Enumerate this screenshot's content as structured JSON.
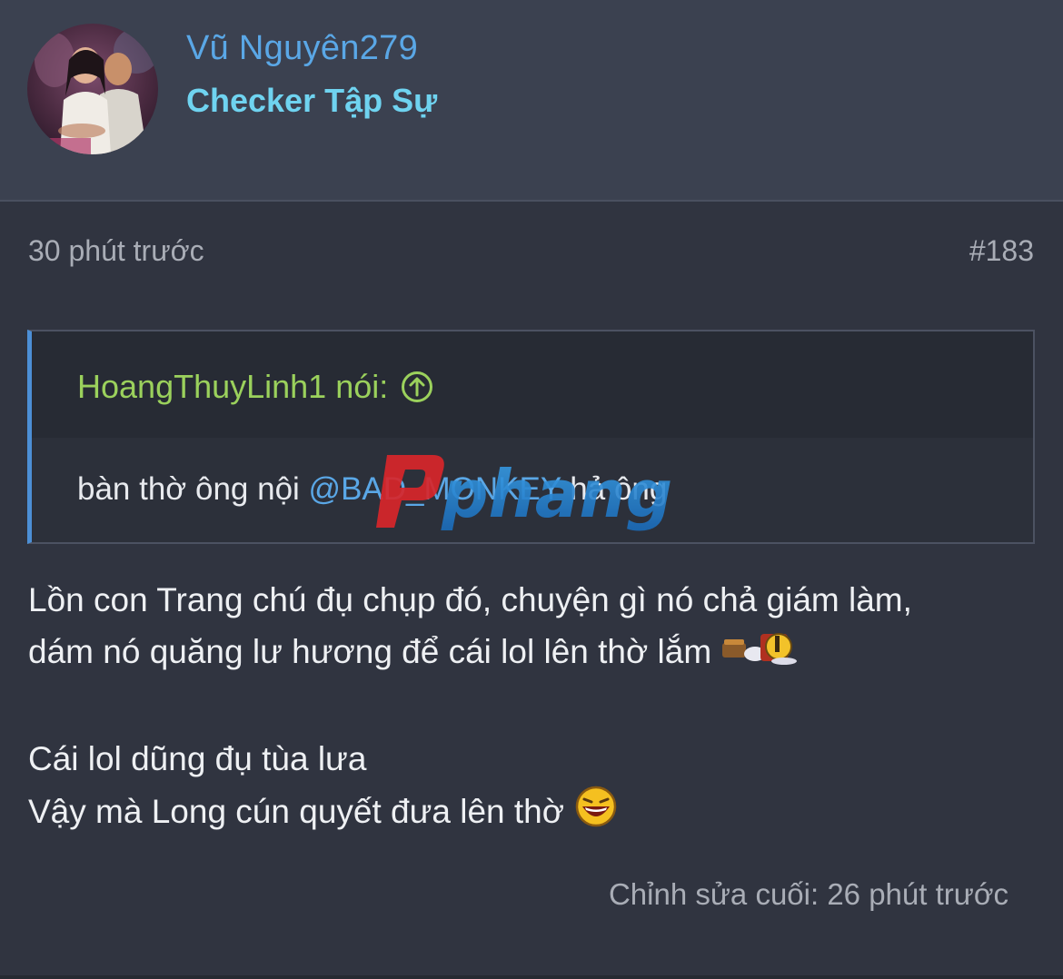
{
  "user": {
    "name": "Vũ Nguyên279",
    "title": "Checker Tập Sự"
  },
  "post": {
    "time": "30 phút trước",
    "number": "#183",
    "quote": {
      "author": "HoangThuyLinh1 nói:",
      "text_before": "bàn thờ ông nội ",
      "mention": "@BAD_MONKEY",
      "text_after": " hả ông"
    },
    "message": {
      "line1": "Lồn con Trang chú đụ chụp đó, chuyện gì nó chả giám làm,",
      "line2": "dám nó quăng lư hương để cái lol lên thờ lắm",
      "line3": "Cái lol dũng đụ tùa lưa",
      "line4": "Vậy mà Long cún quyết đưa lên thờ"
    },
    "edit_note": "Chỉnh sửa cuối: 26 phút trước"
  },
  "watermark": "phang",
  "icons": {
    "quote_jump": "arrow-up-circle-icon",
    "emoji_1": "sleeping-emoji-icon",
    "emoji_2": "laughing-emoji-icon"
  },
  "colors": {
    "username": "#5aa7e6",
    "user_title": "#6fd3f0",
    "quote_author": "#9bd15c",
    "quote_border": "#4c8fd6",
    "mention": "#5aa7e6"
  }
}
